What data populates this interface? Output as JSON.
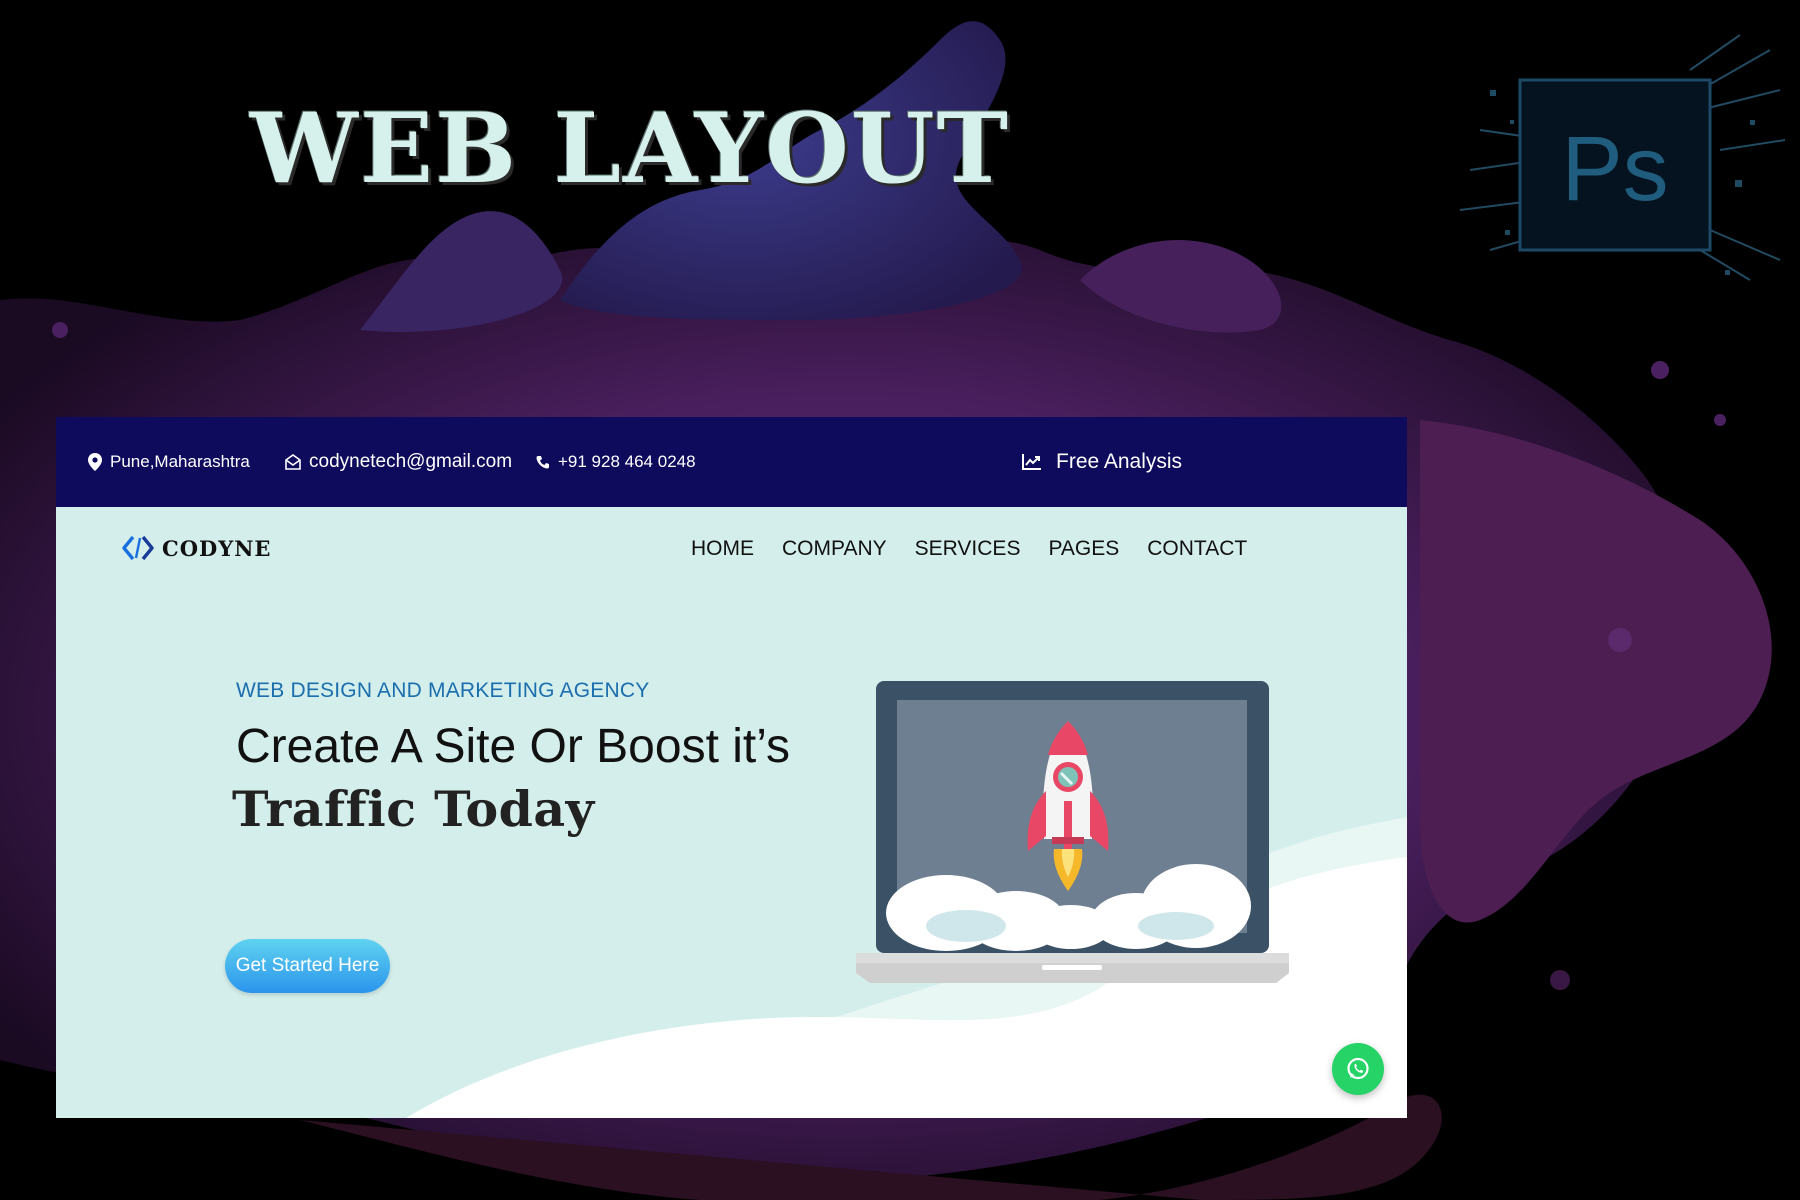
{
  "poster": {
    "title": "WEB LAYOUT",
    "ps_logo_text": "Ps",
    "ps_logo_icon": "photoshop-logo-icon"
  },
  "website": {
    "topbar": {
      "location": "Pune,Maharashtra",
      "location_icon": "map-pin-icon",
      "email": "codynetech@gmail.com",
      "email_icon": "envelope-icon",
      "phone": "+91 928 464 0248",
      "phone_icon": "phone-icon",
      "analysis": "Free Analysis",
      "analysis_icon": "trending-chart-icon"
    },
    "brand": {
      "name": "CODYNE",
      "logo_icon": "code-brackets-icon"
    },
    "nav": [
      "HOME",
      "COMPANY",
      "SERVICES",
      "PAGES",
      "CONTACT"
    ],
    "hero": {
      "tagline": "WEB DESIGN AND MARKETING AGENCY",
      "headline": "Create A Site Or Boost it’s",
      "headline_bold": "Traffic Today",
      "cta_label": "Get Started Here",
      "illustration_icon": "laptop-rocket-illustration"
    },
    "floating": {
      "whatsapp_icon": "whatsapp-icon"
    }
  },
  "colors": {
    "topbar_bg": "#0e0b5c",
    "hero_bg": "#d3eeeb",
    "tagline": "#1b6fae",
    "cta_gradient": [
      "#5fd3f0",
      "#2b94ec"
    ],
    "whatsapp": "#25d366",
    "splash_purple": "#5b2a6e"
  }
}
